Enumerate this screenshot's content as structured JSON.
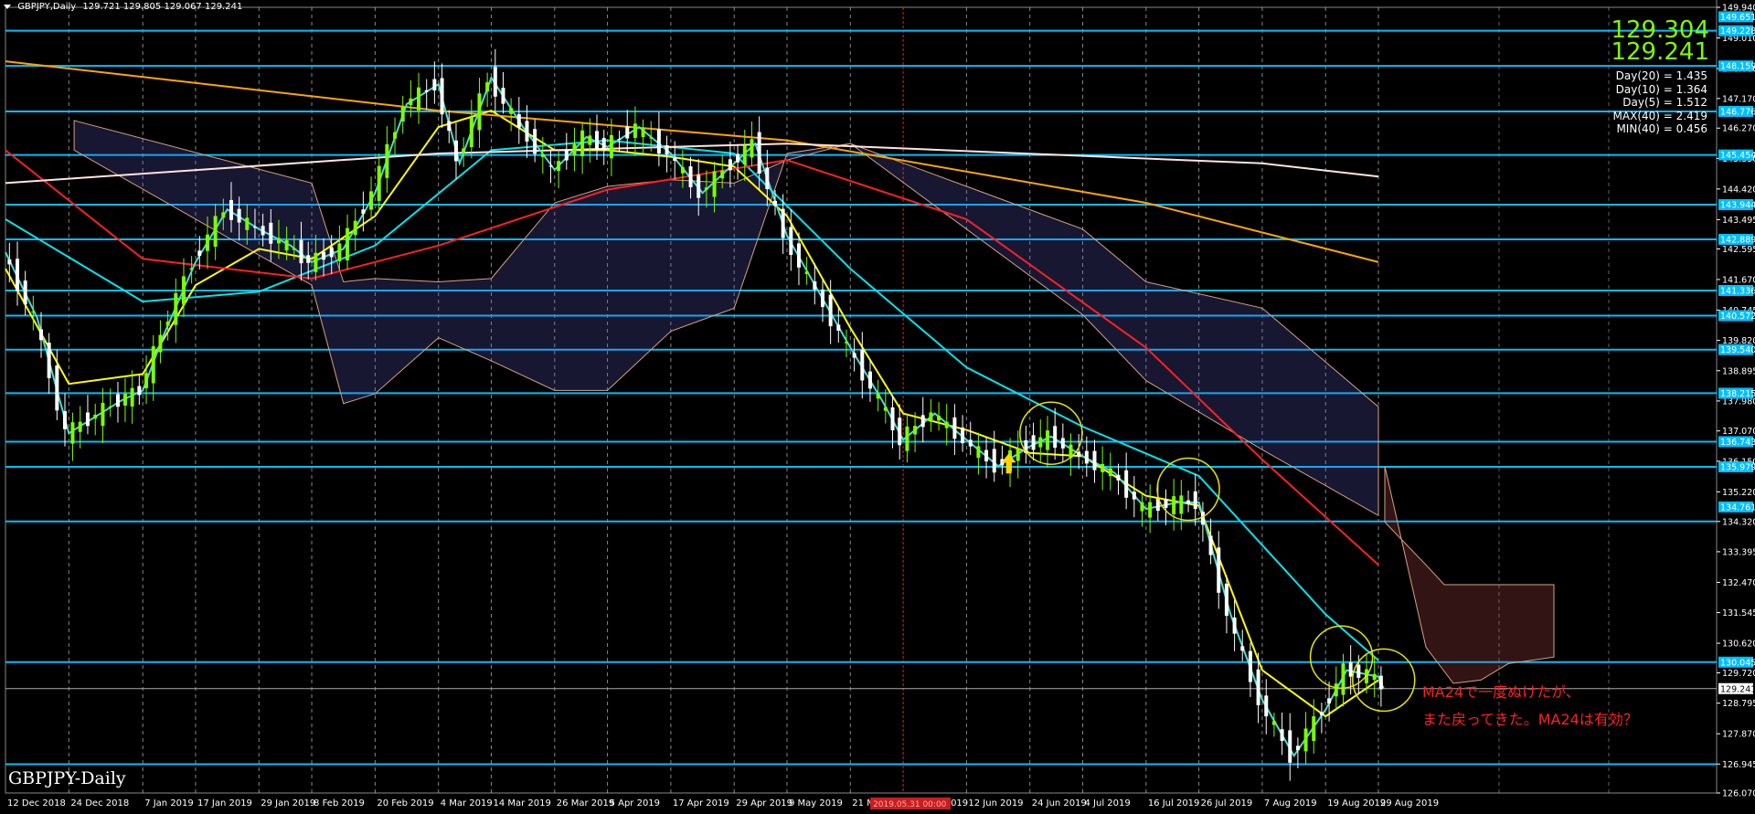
{
  "header": {
    "symbol_period": "GBPJPY,Daily",
    "ohlc": "129.721 129.805 129.067 129.241"
  },
  "big_prices": {
    "bid": "129.304",
    "ask": "129.241"
  },
  "stats": [
    "Day(20) = 1.435",
    "Day(10) = 1.364",
    "Day(5) = 1.512",
    "MAX(40) = 2.419",
    "MIN(40) = 0.456"
  ],
  "symbol_label": "GBPJPY-Daily",
  "note": {
    "line1": "MA24で一度ぬけたが、",
    "line2": "また戻ってきた。MA24は有効？"
  },
  "colors": {
    "background": "#000000",
    "grid": "#c0c0c0",
    "horizontal_level": "#00bfff",
    "highlight_level": "#00bfff",
    "candle_up": "#7cfc00",
    "candle_down": "#ffffff",
    "annotation_circle": "#e6e600",
    "arrow": "#ffd700",
    "note_text": "#ff2020",
    "vertical_marker": "#e02020"
  },
  "chart_data": {
    "type": "candlestick",
    "symbol": "GBPJPY",
    "timeframe": "Daily",
    "price_axis": {
      "min": 126.07,
      "max": 149.94,
      "ticks": [
        149.94,
        149.01,
        148.08,
        147.17,
        146.27,
        145.35,
        144.42,
        143.49,
        142.6,
        141.67,
        140.74,
        139.82,
        138.9,
        137.98,
        137.07,
        136.15,
        135.22,
        134.32,
        133.4,
        132.47,
        131.55,
        130.62,
        129.72,
        128.8,
        127.87,
        126.95,
        126.07
      ],
      "tick_labels": [
        "149.940",
        "149.010",
        "148.080",
        "147.170",
        "146.270",
        "145.350",
        "144.420",
        "143.495",
        "142.595",
        "141.670",
        "140.745",
        "139.820",
        "138.895",
        "137.980",
        "137.070",
        "136.150",
        "135.220",
        "134.320",
        "133.395",
        "132.470",
        "131.545",
        "130.620",
        "129.720",
        "128.795",
        "127.870",
        "126.945",
        "126.070"
      ]
    },
    "level_labels": [
      {
        "value": 149.651,
        "label": "149.651",
        "highlight": true
      },
      {
        "value": 149.228,
        "label": "149.228",
        "highlight": true
      },
      {
        "value": 148.159,
        "label": "148.159",
        "highlight": true
      },
      {
        "value": 146.776,
        "label": "146.776",
        "highlight": true
      },
      {
        "value": 145.454,
        "label": "145.454",
        "highlight": true
      },
      {
        "value": 143.944,
        "label": "143.944",
        "highlight": true
      },
      {
        "value": 142.889,
        "label": "142.889",
        "highlight": true
      },
      {
        "value": 141.336,
        "label": "141.336",
        "highlight": true
      },
      {
        "value": 140.572,
        "label": "140.572",
        "highlight": true
      },
      {
        "value": 139.54,
        "label": "139.540",
        "highlight": true
      },
      {
        "value": 138.215,
        "label": "138.215",
        "highlight": true
      },
      {
        "value": 136.743,
        "label": "136.743",
        "highlight": true
      },
      {
        "value": 135.979,
        "label": "135.979",
        "highlight": true
      },
      {
        "value": 134.761,
        "label": "134.761",
        "highlight": true
      },
      {
        "value": 130.045,
        "label": "130.045",
        "highlight": true
      },
      {
        "value": 129.241,
        "label": "129.241",
        "highlight": false
      }
    ],
    "horizontal_levels": [
      149.228,
      148.159,
      146.776,
      145.454,
      143.944,
      142.889,
      141.336,
      140.572,
      139.54,
      138.215,
      136.743,
      135.979,
      134.32,
      130.045,
      126.945
    ],
    "current_price": 129.241,
    "time_axis": [
      "12 Dec 2018",
      "24 Dec 2018",
      "7 Jan 2019",
      "17 Jan 2019",
      "29 Jan 2019",
      "8 Feb 2019",
      "20 Feb 2019",
      "4 Mar 2019",
      "14 Mar 2019",
      "26 Mar 2019",
      "5 Apr 2019",
      "17 Apr 2019",
      "29 Apr 2019",
      "9 May 2019",
      "21 Ma",
      "2019.05.31 00:00",
      "12 Jun 2019",
      "24 Jun 2019",
      "4 Jul 2019",
      "16 Jul 2019",
      "26 Jul 2019",
      "7 Aug 2019",
      "19 Aug 2019",
      "29 Aug 2019"
    ],
    "time_axis_tail": "019",
    "vertical_marker_label": "2019.05.31 00:00",
    "close_path": [
      [
        "12 Dec 2018",
        142.5
      ],
      [
        "18 Dec 2018",
        140.5
      ],
      [
        "24 Dec 2018",
        137.0
      ],
      [
        "3 Jan 2019",
        138.0
      ],
      [
        "7 Jan 2019",
        138.3
      ],
      [
        "11 Jan 2019",
        140.0
      ],
      [
        "17 Jan 2019",
        142.2
      ],
      [
        "23 Jan 2019",
        143.8
      ],
      [
        "29 Jan 2019",
        143.2
      ],
      [
        "4 Feb 2019",
        142.7
      ],
      [
        "8 Feb 2019",
        142.2
      ],
      [
        "14 Feb 2019",
        142.6
      ],
      [
        "20 Feb 2019",
        144.3
      ],
      [
        "26 Feb 2019",
        147.0
      ],
      [
        "4 Mar 2019",
        147.6
      ],
      [
        "8 Mar 2019",
        145.2
      ],
      [
        "14 Mar 2019",
        147.8
      ],
      [
        "20 Mar 2019",
        146.3
      ],
      [
        "26 Mar 2019",
        145.0
      ],
      [
        "1 Apr 2019",
        146.0
      ],
      [
        "5 Apr 2019",
        145.7
      ],
      [
        "11 Apr 2019",
        146.3
      ],
      [
        "17 Apr 2019",
        145.5
      ],
      [
        "23 Apr 2019",
        144.3
      ],
      [
        "29 Apr 2019",
        145.2
      ],
      [
        "3 May 2019",
        145.8
      ],
      [
        "9 May 2019",
        143.0
      ],
      [
        "15 May 2019",
        141.3
      ],
      [
        "21 May 2019",
        139.6
      ],
      [
        "27 May 2019",
        138.0
      ],
      [
        "31 May 2019",
        136.8
      ],
      [
        "6 Jun 2019",
        137.6
      ],
      [
        "12 Jun 2019",
        136.8
      ],
      [
        "18 Jun 2019",
        136.0
      ],
      [
        "24 Jun 2019",
        136.6
      ],
      [
        "28 Jun 2019",
        136.9
      ],
      [
        "4 Jul 2019",
        136.3
      ],
      [
        "10 Jul 2019",
        135.8
      ],
      [
        "16 Jul 2019",
        134.7
      ],
      [
        "22 Jul 2019",
        134.9
      ],
      [
        "26 Jul 2019",
        134.9
      ],
      [
        "1 Aug 2019",
        131.5
      ],
      [
        "7 Aug 2019",
        128.9
      ],
      [
        "13 Aug 2019",
        127.2
      ],
      [
        "19 Aug 2019",
        128.6
      ],
      [
        "23 Aug 2019",
        129.8
      ],
      [
        "29 Aug 2019",
        129.6
      ],
      [
        "30 Aug 2019",
        129.241
      ]
    ],
    "moving_averages": [
      {
        "color": "#ffff00",
        "points": [
          [
            "12 Dec 2018",
            142.0
          ],
          [
            "24 Dec 2018",
            138.5
          ],
          [
            "7 Jan 2019",
            138.8
          ],
          [
            "17 Jan 2019",
            141.5
          ],
          [
            "29 Jan 2019",
            142.6
          ],
          [
            "8 Feb 2019",
            142.3
          ],
          [
            "20 Feb 2019",
            143.6
          ],
          [
            "4 Mar 2019",
            146.3
          ],
          [
            "14 Mar 2019",
            146.8
          ],
          [
            "26 Mar 2019",
            145.6
          ],
          [
            "5 Apr 2019",
            145.6
          ],
          [
            "17 Apr 2019",
            145.4
          ],
          [
            "29 Apr 2019",
            145.1
          ],
          [
            "9 May 2019",
            143.6
          ],
          [
            "21 May 2019",
            140.2
          ],
          [
            "31 May 2019",
            137.6
          ],
          [
            "12 Jun 2019",
            137.1
          ],
          [
            "24 Jun 2019",
            136.4
          ],
          [
            "4 Jul 2019",
            136.3
          ],
          [
            "16 Jul 2019",
            135.1
          ],
          [
            "26 Jul 2019",
            134.8
          ],
          [
            "7 Aug 2019",
            129.8
          ],
          [
            "19 Aug 2019",
            128.4
          ],
          [
            "29 Aug 2019",
            129.5
          ]
        ]
      },
      {
        "color": "#00e5ee",
        "points": [
          [
            "12 Dec 2018",
            143.5
          ],
          [
            "7 Jan 2019",
            141.0
          ],
          [
            "29 Jan 2019",
            141.3
          ],
          [
            "20 Feb 2019",
            142.7
          ],
          [
            "14 Mar 2019",
            145.6
          ],
          [
            "5 Apr 2019",
            145.9
          ],
          [
            "29 Apr 2019",
            145.5
          ],
          [
            "21 May 2019",
            142.0
          ],
          [
            "12 Jun 2019",
            139.0
          ],
          [
            "4 Jul 2019",
            137.2
          ],
          [
            "26 Jul 2019",
            135.7
          ],
          [
            "19 Aug 2019",
            131.5
          ],
          [
            "29 Aug 2019",
            130.1
          ]
        ]
      },
      {
        "color": "#ff2020",
        "points": [
          [
            "12 Dec 2018",
            145.6
          ],
          [
            "7 Jan 2019",
            142.3
          ],
          [
            "8 Feb 2019",
            141.7
          ],
          [
            "4 Mar 2019",
            142.7
          ],
          [
            "5 Apr 2019",
            144.4
          ],
          [
            "9 May 2019",
            145.3
          ],
          [
            "12 Jun 2019",
            143.5
          ],
          [
            "16 Jul 2019",
            139.6
          ],
          [
            "7 Aug 2019",
            136.2
          ],
          [
            "29 Aug 2019",
            133.0
          ]
        ]
      },
      {
        "color": "#ffa500",
        "points": [
          [
            "12 Dec 2018",
            148.3
          ],
          [
            "4 Mar 2019",
            146.8
          ],
          [
            "9 May 2019",
            145.9
          ],
          [
            "16 Jul 2019",
            144.0
          ],
          [
            "29 Aug 2019",
            142.2
          ]
        ]
      },
      {
        "color": "#ffe4e1",
        "points": [
          [
            "12 Dec 2018",
            144.6
          ],
          [
            "4 Mar 2019",
            145.5
          ],
          [
            "9 May 2019",
            145.8
          ],
          [
            "7 Aug 2019",
            145.2
          ],
          [
            "29 Aug 2019",
            144.8
          ]
        ]
      }
    ],
    "annotations": [
      {
        "type": "circle",
        "at": [
          "28 Jun 2019",
          137.0
        ]
      },
      {
        "type": "circle",
        "at": [
          "24 Jul 2019",
          135.3
        ]
      },
      {
        "type": "circle",
        "at": [
          "22 Aug 2019",
          130.2
        ]
      },
      {
        "type": "circle",
        "at": [
          "30 Aug 2019",
          129.5
        ]
      },
      {
        "type": "arrow-up",
        "at": [
          "20 Jun 2019",
          136.0
        ]
      }
    ]
  }
}
